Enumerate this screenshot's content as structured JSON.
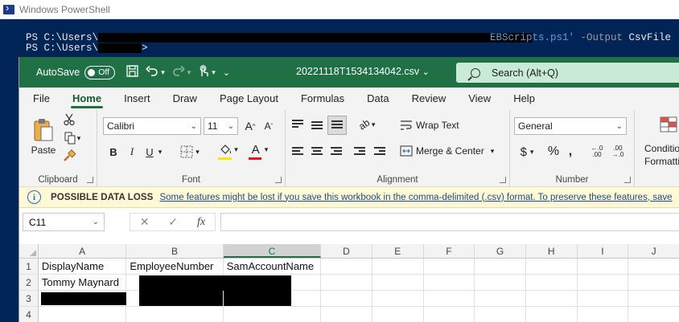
{
  "powershell": {
    "title": "Windows PowerShell",
    "line1_prompt": "PS C:\\Users\\",
    "line1_script": "EBScripts.ps1'",
    "line1_param": " -Output ",
    "line1_arg": "CsvFile",
    "line2_prompt": "PS C:\\Users\\",
    "line2_end": ">",
    "colors": {
      "background": "#012456",
      "string": "#5f9bd6"
    }
  },
  "excel": {
    "autosave_label": "AutoSave",
    "autosave_state": "Off",
    "filename": "20221118T1534134042.csv",
    "search_placeholder": "Search (Alt+Q)",
    "tabs": [
      "File",
      "Home",
      "Insert",
      "Draw",
      "Page Layout",
      "Formulas",
      "Data",
      "Review",
      "View",
      "Help"
    ],
    "active_tab": "Home",
    "ribbon": {
      "clipboard": {
        "label": "Clipboard",
        "paste": "Paste"
      },
      "font": {
        "label": "Font",
        "family": "Calibri",
        "size": "11",
        "bold": "B",
        "italic": "I",
        "underline": "U"
      },
      "alignment": {
        "label": "Alignment",
        "wrap_text": "Wrap Text",
        "merge_center": "Merge & Center"
      },
      "number": {
        "label": "Number",
        "format": "General"
      },
      "styles": {
        "conditional_line1": "Condition",
        "conditional_line2": "Formattin"
      }
    },
    "infobar": {
      "title": "POSSIBLE DATA LOSS",
      "message": "Some features might be lost if you save this workbook in the comma-delimited (.csv) format. To preserve these features, save"
    },
    "name_box": "C11",
    "columns": [
      "A",
      "B",
      "C",
      "D",
      "E",
      "F",
      "G",
      "H",
      "I",
      "J"
    ],
    "selected_column": "C",
    "rows": [
      {
        "num": "1",
        "cells": [
          "DisplayName",
          "EmployeeNumber",
          "SamAccountName"
        ]
      },
      {
        "num": "2",
        "cells": [
          "Tommy Maynard",
          "",
          ""
        ]
      },
      {
        "num": "3",
        "cells": [
          "",
          "",
          ""
        ]
      },
      {
        "num": "4",
        "cells": [
          "",
          "",
          ""
        ]
      }
    ],
    "colors": {
      "brand": "#1f7145",
      "infobar_bg": "#fff9d6",
      "link": "#1b4d8b"
    }
  }
}
